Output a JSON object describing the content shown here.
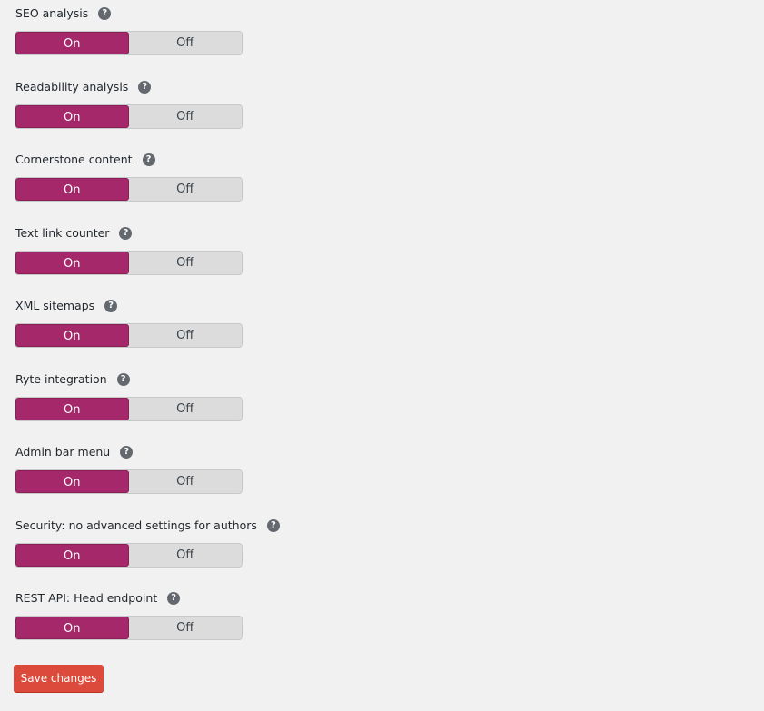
{
  "settings": [
    {
      "label": "SEO analysis",
      "on_label": "On",
      "off_label": "Off",
      "value": "On"
    },
    {
      "label": "Readability analysis",
      "on_label": "On",
      "off_label": "Off",
      "value": "On"
    },
    {
      "label": "Cornerstone content",
      "on_label": "On",
      "off_label": "Off",
      "value": "On"
    },
    {
      "label": "Text link counter",
      "on_label": "On",
      "off_label": "Off",
      "value": "On"
    },
    {
      "label": "XML sitemaps",
      "on_label": "On",
      "off_label": "Off",
      "value": "On"
    },
    {
      "label": "Ryte integration",
      "on_label": "On",
      "off_label": "Off",
      "value": "On"
    },
    {
      "label": "Admin bar menu",
      "on_label": "On",
      "off_label": "Off",
      "value": "On"
    },
    {
      "label": "Security: no advanced settings for authors",
      "on_label": "On",
      "off_label": "Off",
      "value": "On"
    },
    {
      "label": "REST API: Head endpoint",
      "on_label": "On",
      "off_label": "Off",
      "value": "On"
    }
  ],
  "help_icon": {
    "glyph": "?"
  },
  "save_button": {
    "label": "Save changes"
  },
  "colors": {
    "page_bg": "#f1f1f1",
    "active_toggle": "#a4286a",
    "inactive_toggle": "#dcdcdc",
    "primary_button": "#dc4a3b",
    "help_icon": "#646970"
  }
}
